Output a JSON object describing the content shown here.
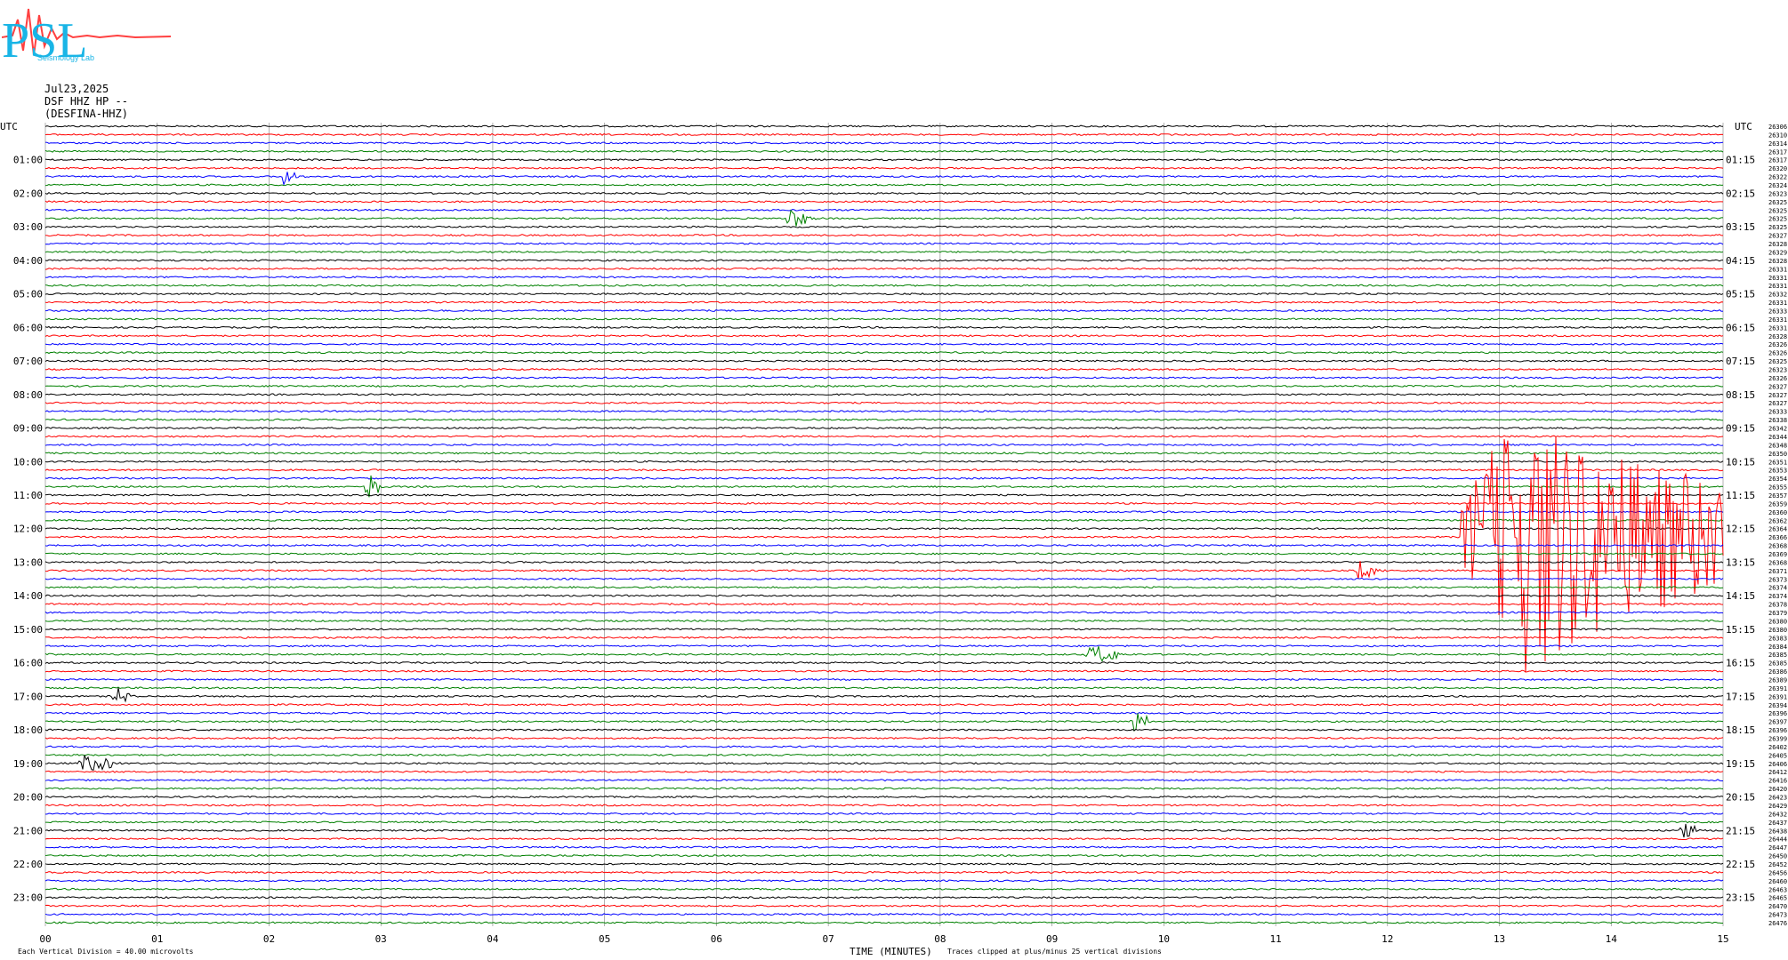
{
  "header": {
    "logo_text": "PSL",
    "logo_subtext": "Seismology Lab",
    "date": "Jul23,2025",
    "station": "DSF HHZ HP --",
    "site": "(DESFINA-HHZ)"
  },
  "footer": {
    "scale_note": "Each Vertical Division =   40.00 microvolts",
    "xlabel": "TIME (MINUTES)",
    "clip_note": "Traces clipped at plus/minus 25 vertical divisions"
  },
  "colors": {
    "trace_cycle": [
      "#000000",
      "#ff0000",
      "#0000ff",
      "#008000"
    ],
    "grid": "#808080"
  },
  "chart_data": {
    "type": "helicorder",
    "title": "",
    "xlabel": "TIME (MINUTES)",
    "ylabel": "UTC",
    "right_ylabel": "UTC",
    "xlim": [
      0,
      15
    ],
    "x_ticks": [
      "00",
      "01",
      "02",
      "03",
      "04",
      "05",
      "06",
      "07",
      "08",
      "09",
      "10",
      "11",
      "12",
      "13",
      "14",
      "15"
    ],
    "row_minutes": 15,
    "row_count": 96,
    "left_hour_labels": [
      "01:00",
      "02:00",
      "03:00",
      "04:00",
      "05:00",
      "06:00",
      "07:00",
      "08:00",
      "09:00",
      "10:00",
      "11:00",
      "12:00",
      "13:00",
      "14:00",
      "15:00",
      "16:00",
      "17:00",
      "18:00",
      "19:00",
      "20:00",
      "21:00",
      "22:00",
      "23:00"
    ],
    "right_hour_labels": [
      "01:15",
      "02:15",
      "03:15",
      "04:15",
      "05:15",
      "06:15",
      "07:15",
      "08:15",
      "09:15",
      "10:15",
      "11:15",
      "12:15",
      "13:15",
      "14:15",
      "15:15",
      "16:15",
      "17:15",
      "18:15",
      "19:15",
      "20:15",
      "21:15",
      "22:15",
      "23:15"
    ],
    "row_offset_counts": [
      26306,
      26310,
      26314,
      26317,
      26317,
      26320,
      26322,
      26324,
      26323,
      26325,
      26325,
      26325,
      26325,
      26327,
      26328,
      26329,
      26328,
      26331,
      26331,
      26331,
      26332,
      26331,
      26333,
      26331,
      26331,
      26328,
      26326,
      26326,
      26325,
      26323,
      26326,
      26327,
      26327,
      26327,
      26333,
      26338,
      26342,
      26344,
      26348,
      26350,
      26351,
      26353,
      26354,
      26355,
      26357,
      26359,
      26360,
      26362,
      26364,
      26366,
      26368,
      26369,
      26368,
      26371,
      26373,
      26374,
      26374,
      26378,
      26379,
      26380,
      26380,
      26383,
      26384,
      26385,
      26385,
      26386,
      26389,
      26391,
      26391,
      26394,
      26396,
      26397,
      26396,
      26399,
      26402,
      26405,
      26406,
      26412,
      26416,
      26420,
      26423,
      26429,
      26432,
      26437,
      26438,
      26444,
      26447,
      26450,
      26452,
      26456,
      26460,
      26463,
      26465,
      26470,
      26473,
      26476
    ],
    "events": [
      {
        "row": 49,
        "minute": 12.65,
        "duration_min": 2.4,
        "amplitude_div": 25,
        "color": "red",
        "note": "large clipped event"
      },
      {
        "row": 11,
        "minute": 6.6,
        "duration_min": 0.25,
        "amplitude_div": 2
      },
      {
        "row": 6,
        "minute": 2.1,
        "duration_min": 0.15,
        "amplitude_div": 2
      },
      {
        "row": 43,
        "minute": 2.85,
        "duration_min": 0.15,
        "amplitude_div": 3
      },
      {
        "row": 53,
        "minute": 11.7,
        "duration_min": 0.2,
        "amplitude_div": 2
      },
      {
        "row": 63,
        "minute": 9.3,
        "duration_min": 0.3,
        "amplitude_div": 2
      },
      {
        "row": 68,
        "minute": 0.6,
        "duration_min": 0.15,
        "amplitude_div": 2
      },
      {
        "row": 71,
        "minute": 9.7,
        "duration_min": 0.15,
        "amplitude_div": 3
      },
      {
        "row": 76,
        "minute": 0.3,
        "duration_min": 0.3,
        "amplitude_div": 2
      },
      {
        "row": 84,
        "minute": 14.6,
        "duration_min": 0.15,
        "amplitude_div": 2
      }
    ]
  }
}
